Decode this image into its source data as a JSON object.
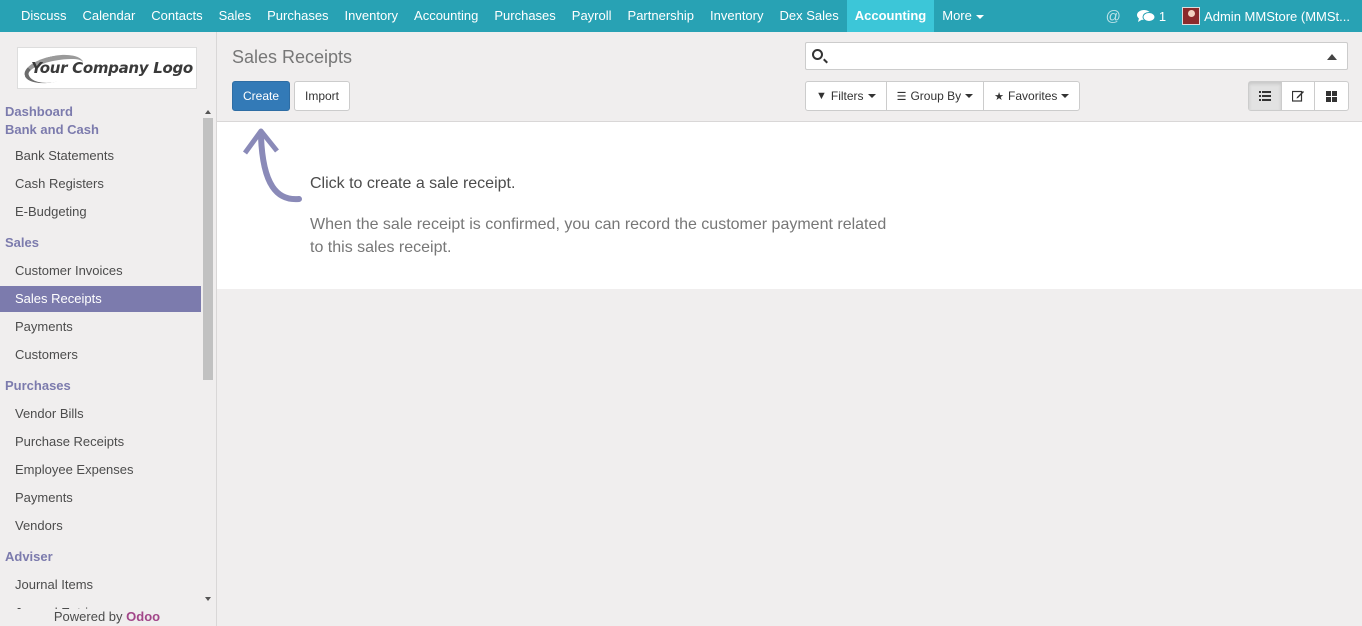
{
  "topbar": {
    "menu": [
      "Discuss",
      "Calendar",
      "Contacts",
      "Sales",
      "Purchases",
      "Inventory",
      "Accounting",
      "Purchases",
      "Payroll",
      "Partnership",
      "Inventory",
      "Dex Sales",
      "Accounting"
    ],
    "active_index": 12,
    "more_label": "More",
    "message_count": "1",
    "user": "Admin MMStore (MMSt..."
  },
  "sidebar": {
    "logo_text": "Your Company Logo",
    "sections": [
      {
        "title": "Dashboard",
        "items": []
      },
      {
        "title": "Bank and Cash",
        "items": [
          "Bank Statements",
          "Cash Registers",
          "E-Budgeting"
        ]
      },
      {
        "title": "Sales",
        "items": [
          "Customer Invoices",
          "Sales Receipts",
          "Payments",
          "Customers"
        ]
      },
      {
        "title": "Purchases",
        "items": [
          "Vendor Bills",
          "Purchase Receipts",
          "Employee Expenses",
          "Payments",
          "Vendors"
        ]
      },
      {
        "title": "Adviser",
        "items": [
          "Journal Items",
          "Journal Entries"
        ]
      }
    ],
    "active_item": "Sales Receipts",
    "powered_prefix": "Powered by ",
    "powered_brand": "Odoo"
  },
  "control_panel": {
    "title": "Sales Receipts",
    "create_label": "Create",
    "import_label": "Import",
    "search_value": "",
    "filters_label": "Filters",
    "groupby_label": "Group By",
    "favorites_label": "Favorites"
  },
  "help": {
    "title": "Click to create a sale receipt.",
    "body": "When the sale receipt is confirmed, you can record the customer payment related to this sales receipt."
  },
  "colors": {
    "topbar": "#28a2b4",
    "topbar_active": "#3cc6d8",
    "accent": "#7c7bad",
    "primary": "#337ab7",
    "brand": "#a24689"
  }
}
